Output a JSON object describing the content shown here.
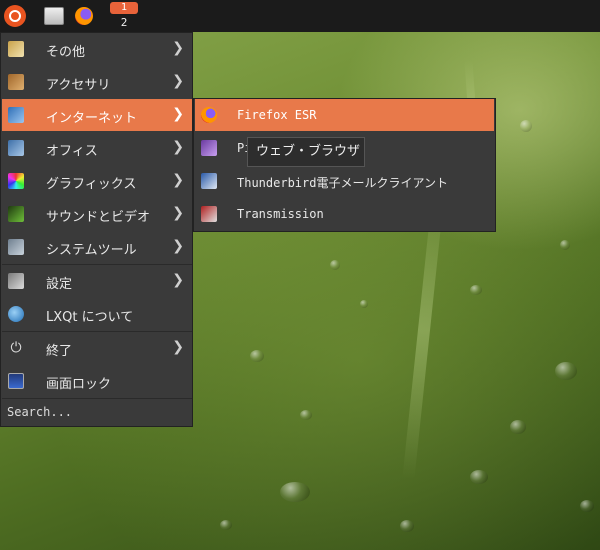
{
  "taskbar": {
    "menu_button": "ubuntu-logo-icon",
    "show_desktop": "desktop-icon",
    "quicklaunch": "firefox-icon",
    "workspaces": [
      "1",
      "2"
    ]
  },
  "menu": {
    "items": [
      {
        "label": "その他",
        "icon": "other-icon",
        "has_submenu": true
      },
      {
        "label": "アクセサリ",
        "icon": "accessories-icon",
        "has_submenu": true
      },
      {
        "label": "インターネット",
        "icon": "internet-icon",
        "has_submenu": true
      },
      {
        "label": "オフィス",
        "icon": "office-icon",
        "has_submenu": true
      },
      {
        "label": "グラフィックス",
        "icon": "graphics-icon",
        "has_submenu": true
      },
      {
        "label": "サウンドとビデオ",
        "icon": "sound-video-icon",
        "has_submenu": true
      },
      {
        "label": "システムツール",
        "icon": "system-tools-icon",
        "has_submenu": true
      },
      {
        "label": "設定",
        "icon": "settings-icon",
        "has_submenu": true
      },
      {
        "label": "LXQt について",
        "icon": "lxqt-icon",
        "has_submenu": false
      },
      {
        "label": "終了",
        "icon": "power-icon",
        "has_submenu": true
      },
      {
        "label": "画面ロック",
        "icon": "lock-screen-icon",
        "has_submenu": false
      }
    ],
    "active_item": "インターネット",
    "search_placeholder": "Search..."
  },
  "submenu": {
    "items": [
      {
        "label": "Firefox ESR",
        "icon": "firefox-icon"
      },
      {
        "label": "Pi",
        "icon": "pidgin-icon"
      },
      {
        "label": "Thunderbird電子メールクライアント",
        "icon": "thunderbird-icon"
      },
      {
        "label": "Transmission",
        "icon": "transmission-icon"
      }
    ],
    "active_item": "Firefox ESR"
  },
  "tooltip": "ウェブ・ブラウザ",
  "colors": {
    "highlight": "#e8794a",
    "menu_bg": "#3a3a3a",
    "taskbar_bg": "#1b1b1b",
    "workspace_active": "#e8633a"
  }
}
